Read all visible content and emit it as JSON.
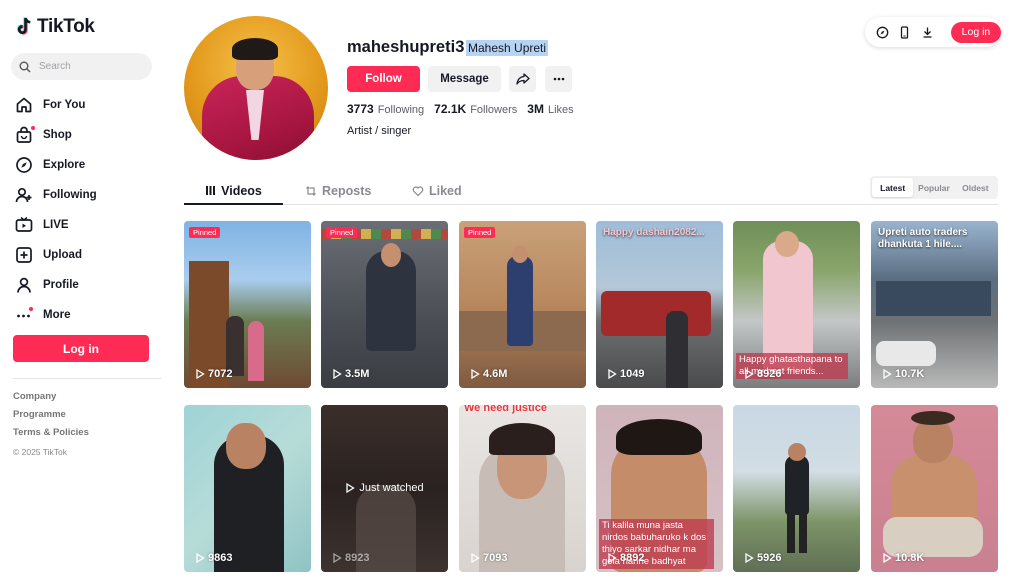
{
  "brand": {
    "name": "TikTok"
  },
  "search": {
    "placeholder": "Search"
  },
  "nav": [
    {
      "label": "For You",
      "icon": "home-icon"
    },
    {
      "label": "Shop",
      "icon": "shop-icon"
    },
    {
      "label": "Explore",
      "icon": "compass-icon"
    },
    {
      "label": "Following",
      "icon": "following-icon"
    },
    {
      "label": "LIVE",
      "icon": "live-icon"
    },
    {
      "label": "Upload",
      "icon": "upload-icon"
    },
    {
      "label": "Profile",
      "icon": "profile-icon"
    },
    {
      "label": "More",
      "icon": "more-icon"
    }
  ],
  "sidebar": {
    "login_label": "Log in",
    "footer": [
      "Company",
      "Programme",
      "Terms & Policies"
    ],
    "copyright": "© 2025 TikTok"
  },
  "topbar": {
    "login_label": "Log in"
  },
  "profile": {
    "username": "maheshupreti3",
    "nickname": "Mahesh Upreti",
    "follow_label": "Follow",
    "message_label": "Message",
    "following_count": "3773",
    "following_label": "Following",
    "followers_count": "72.1K",
    "followers_label": "Followers",
    "likes_count": "3M",
    "likes_label": "Likes",
    "bio": "Artist / singer"
  },
  "tabs": [
    {
      "label": "Videos",
      "active": true
    },
    {
      "label": "Reposts",
      "active": false
    },
    {
      "label": "Liked",
      "active": false
    }
  ],
  "sort": [
    {
      "label": "Latest",
      "active": true
    },
    {
      "label": "Popular",
      "active": false
    },
    {
      "label": "Oldest",
      "active": false
    }
  ],
  "videos": [
    {
      "views": "7072",
      "pinned": "Pinned"
    },
    {
      "views": "3.5M",
      "pinned": "Pinned"
    },
    {
      "views": "4.6M",
      "pinned": "Pinned"
    },
    {
      "views": "1049",
      "caption": "Happy dashain2082..."
    },
    {
      "views": "8926",
      "caption": "Happy ghatasthapana to all my best friends..."
    },
    {
      "views": "10.7K",
      "caption": "Upreti auto traders dhankuta 1 hile...."
    },
    {
      "views": "9863"
    },
    {
      "views": "8923",
      "watched": "Just watched"
    },
    {
      "views": "7093",
      "caption": "We need justice"
    },
    {
      "views": "8892",
      "caption": "Ti kalila muna jasta nirdos babuharuko k dos thiyo sarkar nidhar ma gola hanne badhyat"
    },
    {
      "views": "5926"
    },
    {
      "views": "10.8K"
    }
  ],
  "colors": {
    "accent": "#fe2c55",
    "text": "#161823",
    "muted": "#8a8b91"
  }
}
